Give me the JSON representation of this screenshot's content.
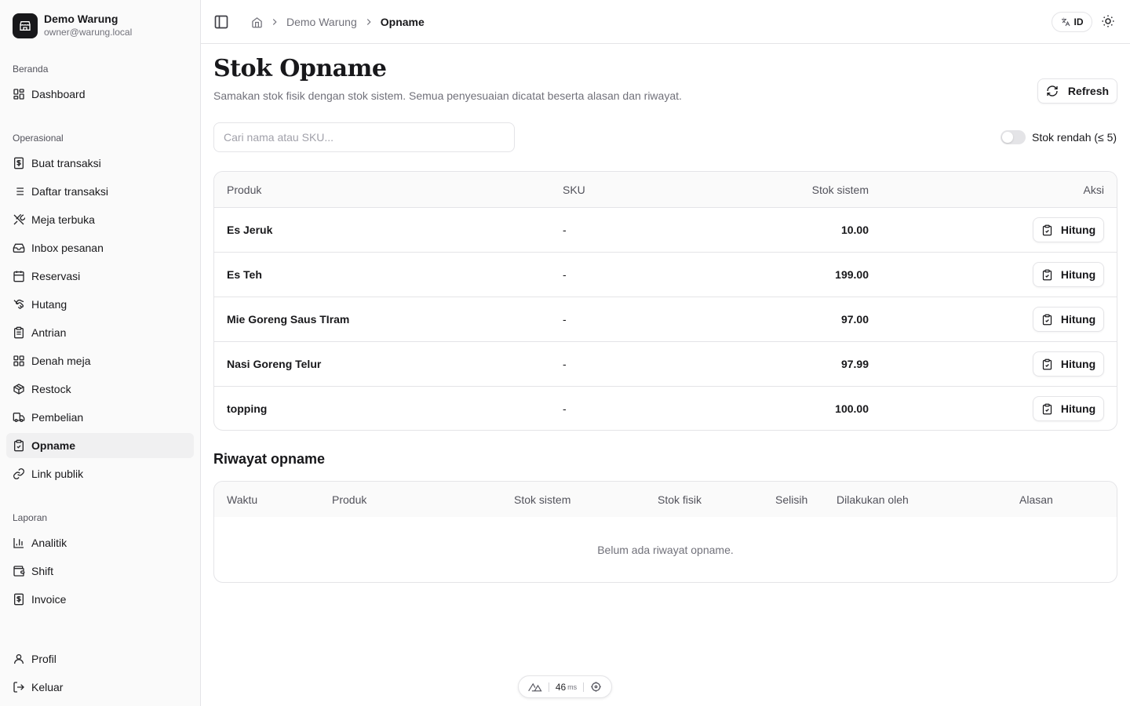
{
  "brand": {
    "name": "Demo Warung",
    "email": "owner@warung.local"
  },
  "sidebar": {
    "groups": [
      {
        "label": "Beranda",
        "items": [
          {
            "label": "Dashboard",
            "icon": "dashboard-icon"
          }
        ]
      },
      {
        "label": "Operasional",
        "items": [
          {
            "label": "Buat transaksi",
            "icon": "receipt-icon"
          },
          {
            "label": "Daftar transaksi",
            "icon": "list-icon"
          },
          {
            "label": "Meja terbuka",
            "icon": "utensils-icon"
          },
          {
            "label": "Inbox pesanan",
            "icon": "inbox-icon"
          },
          {
            "label": "Reservasi",
            "icon": "calendar-icon"
          },
          {
            "label": "Hutang",
            "icon": "handshake-icon"
          },
          {
            "label": "Antrian",
            "icon": "clipboard-icon"
          },
          {
            "label": "Denah meja",
            "icon": "grid-icon"
          },
          {
            "label": "Restock",
            "icon": "package-icon"
          },
          {
            "label": "Pembelian",
            "icon": "truck-icon"
          },
          {
            "label": "Opname",
            "icon": "clipboard-check-icon",
            "active": true
          },
          {
            "label": "Link publik",
            "icon": "link-icon"
          }
        ]
      },
      {
        "label": "Laporan",
        "items": [
          {
            "label": "Analitik",
            "icon": "chart-icon"
          },
          {
            "label": "Shift",
            "icon": "wallet-icon"
          },
          {
            "label": "Invoice",
            "icon": "invoice-icon"
          }
        ]
      }
    ],
    "bottom": [
      {
        "label": "Profil",
        "icon": "user-icon"
      },
      {
        "label": "Keluar",
        "icon": "logout-icon"
      }
    ]
  },
  "header": {
    "breadcrumb": [
      "Demo Warung",
      "Opname"
    ],
    "lang": "ID"
  },
  "page": {
    "title": "Stok Opname",
    "subtitle": "Samakan stok fisik dengan stok sistem. Semua penyesuaian dicatat beserta alasan dan riwayat.",
    "refresh_label": "Refresh",
    "search_placeholder": "Cari nama atau SKU...",
    "low_stock_label": "Stok rendah (≤ 5)"
  },
  "stock_table": {
    "columns": [
      "Produk",
      "SKU",
      "Stok sistem",
      "Aksi"
    ],
    "action_label": "Hitung",
    "rows": [
      {
        "product": "Es Jeruk",
        "sku": "-",
        "stock": "10.00"
      },
      {
        "product": "Es Teh",
        "sku": "-",
        "stock": "199.00"
      },
      {
        "product": "Mie Goreng Saus TIram",
        "sku": "-",
        "stock": "97.00"
      },
      {
        "product": "Nasi Goreng Telur",
        "sku": "-",
        "stock": "97.99"
      },
      {
        "product": "topping",
        "sku": "-",
        "stock": "100.00"
      }
    ]
  },
  "history": {
    "title": "Riwayat opname",
    "columns": [
      "Waktu",
      "Produk",
      "Stok sistem",
      "Stok fisik",
      "Selisih",
      "Dilakukan oleh",
      "Alasan"
    ],
    "empty": "Belum ada riwayat opname."
  },
  "devbar": {
    "ms": "46",
    "unit": "ms"
  }
}
